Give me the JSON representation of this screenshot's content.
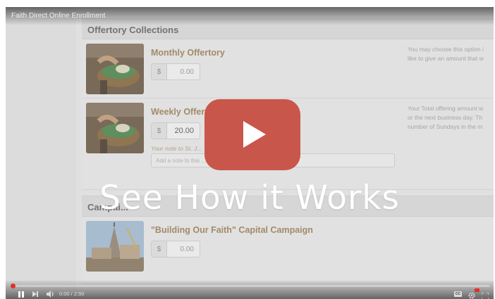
{
  "video": {
    "title": "Faith Direct Online Enrollment",
    "overlay_text": "See How it Works",
    "time_display": "0:00 / 2:50",
    "cc_label": "CC"
  },
  "sections": {
    "offertory_title": "Offertory Collections",
    "campaign_title": "Campai..."
  },
  "items": {
    "monthly": {
      "title": "Monthly Offertory",
      "currency": "$",
      "amount": "0.00",
      "desc_line1": "You may choose this option i",
      "desc_line2": "like to give an amount that w"
    },
    "weekly": {
      "title": "Weekly Offert...",
      "currency": "$",
      "amount": "20.00",
      "note_label": "Your note to St. J...",
      "note_placeholder": "Add a note to this ...",
      "desc_line1": "Your Total offering amount w",
      "desc_line2": "or the next business day. Th",
      "desc_line3": "number of Sundays in the m"
    },
    "campaign": {
      "title": "\"Building Our Faith\" Capital Campaign",
      "currency": "$",
      "amount": "0.00"
    }
  },
  "icons": {
    "play": "play-icon",
    "pause": "pause-icon",
    "next": "next-icon",
    "volume": "volume-icon",
    "settings": "gear-icon",
    "fullscreen": "fullscreen-icon"
  },
  "colors": {
    "play_button": "#c9564a",
    "progress_dot": "#e52d27",
    "item_title": "#a3855a"
  }
}
